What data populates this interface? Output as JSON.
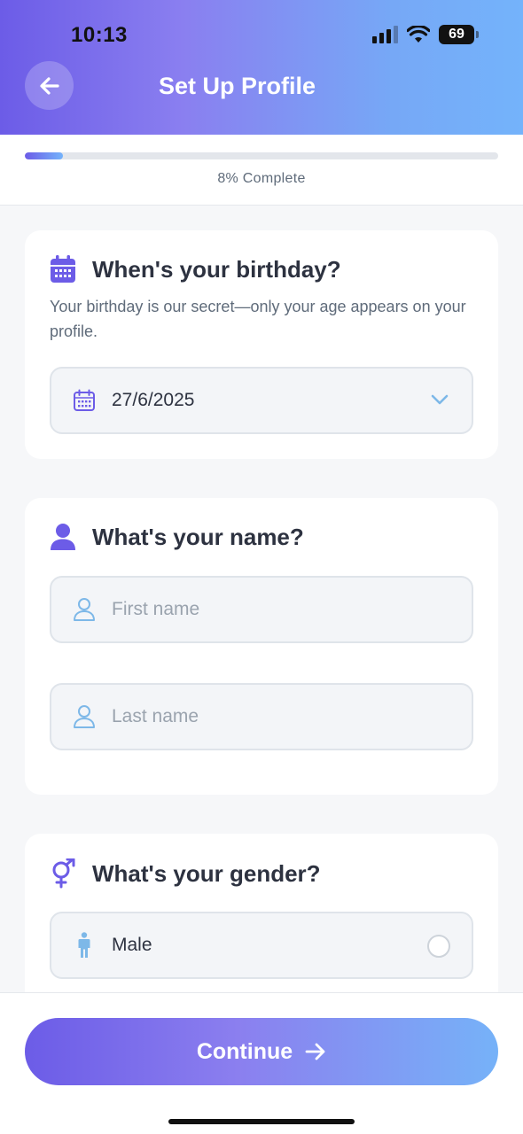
{
  "status_bar": {
    "time": "10:13",
    "battery": "69"
  },
  "header": {
    "title": "Set Up Profile",
    "back_icon": "arrow-left-icon"
  },
  "progress": {
    "percent": 8,
    "label": "8% Complete"
  },
  "birthday_card": {
    "title": "When's your birthday?",
    "description": "Your birthday is our secret—only your age appears on your profile.",
    "date_value": "27/6/2025",
    "icon": "calendar-icon"
  },
  "name_card": {
    "title": "What's your name?",
    "first_name_placeholder": "First name",
    "first_name_value": "",
    "last_name_placeholder": "Last name",
    "last_name_value": "",
    "icon": "person-icon"
  },
  "gender_card": {
    "title": "What's your gender?",
    "options": [
      {
        "label": "Male",
        "selected": false
      }
    ],
    "icon": "gender-icon"
  },
  "footer": {
    "continue_label": "Continue"
  },
  "colors": {
    "accent_start": "#6c5ce7",
    "accent_end": "#74b3fb",
    "icon_blue": "#7db8e8"
  }
}
